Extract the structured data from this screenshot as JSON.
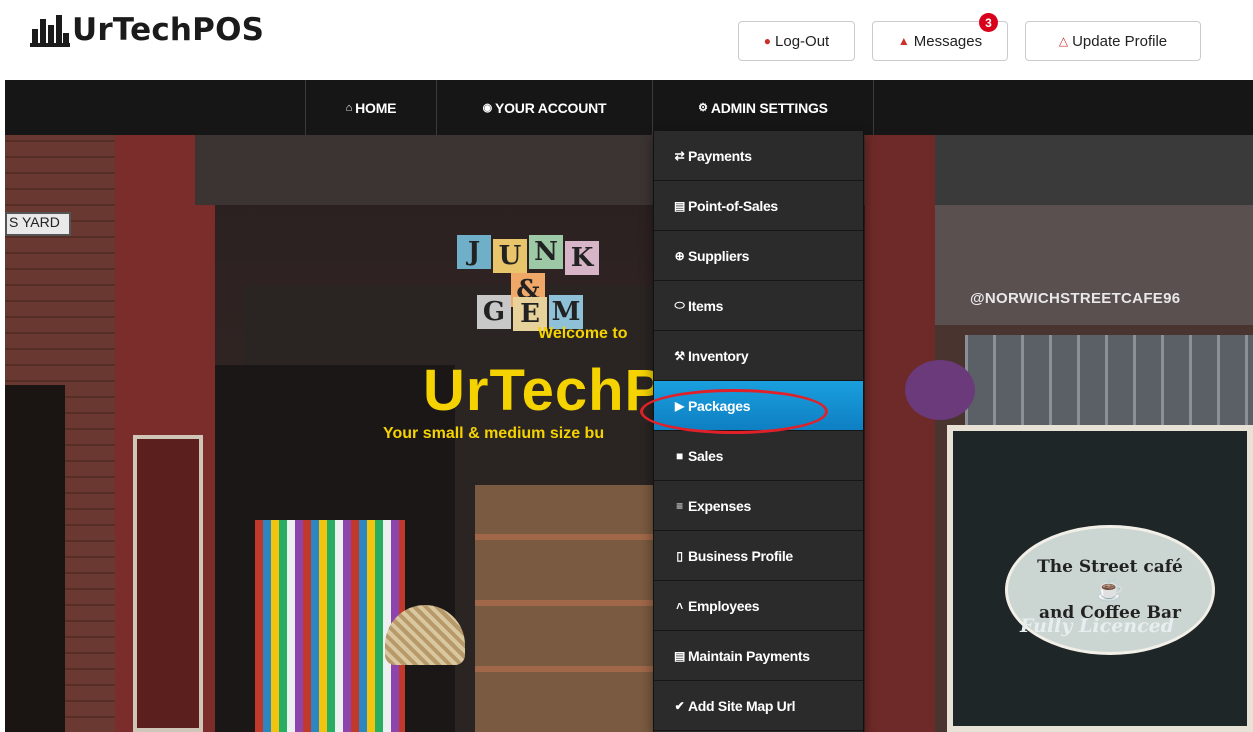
{
  "brand": {
    "name": "UrTechPOS",
    "logo_icon": "chart-logo-icon"
  },
  "header_buttons": {
    "logout": {
      "label": "Log-Out",
      "icon": "lock-icon"
    },
    "messages": {
      "label": "Messages",
      "icon": "envelope-icon",
      "badge": "3"
    },
    "profile": {
      "label": "Update Profile",
      "icon": "user-icon"
    }
  },
  "nav": {
    "home": {
      "label": "HOME",
      "icon": "home-icon"
    },
    "account": {
      "label": "YOUR ACCOUNT",
      "icon": "account-icon"
    },
    "admin": {
      "label": "ADMIN SETTINGS",
      "icon": "gear-icon"
    }
  },
  "dropdown": {
    "items": [
      {
        "label": "Payments",
        "icon": "transfer-icon"
      },
      {
        "label": "Point-of-Sales",
        "icon": "card-icon"
      },
      {
        "label": "Suppliers",
        "icon": "plus-circle-icon"
      },
      {
        "label": "Items",
        "icon": "tag-icon"
      },
      {
        "label": "Inventory",
        "icon": "wrench-icon"
      },
      {
        "label": "Packages",
        "icon": "arrow-circle-icon",
        "active": true
      },
      {
        "label": "Sales",
        "icon": "book-icon"
      },
      {
        "label": "Expenses",
        "icon": "expenses-icon"
      },
      {
        "label": "Business Profile",
        "icon": "clipboard-icon"
      },
      {
        "label": "Employees",
        "icon": "caret-up-icon"
      },
      {
        "label": "Maintain Payments",
        "icon": "card-icon"
      },
      {
        "label": "Add Site Map Url",
        "icon": "check-circle-icon"
      }
    ],
    "active_color": "#1a9fde",
    "highlight_color": "#e0212a"
  },
  "hero": {
    "welcome": "Welcome to",
    "title": "UrTechP",
    "subtitle": "Your small & medium size bu",
    "accent_color": "#f5d300",
    "sign_yard": "S YARD",
    "cafe_handle": "@NORWICHSTREETCAFE96",
    "cafe_line1": "The Street café",
    "cafe_line2": "and Coffee Bar",
    "cafe_script": "Fully Licenced"
  }
}
